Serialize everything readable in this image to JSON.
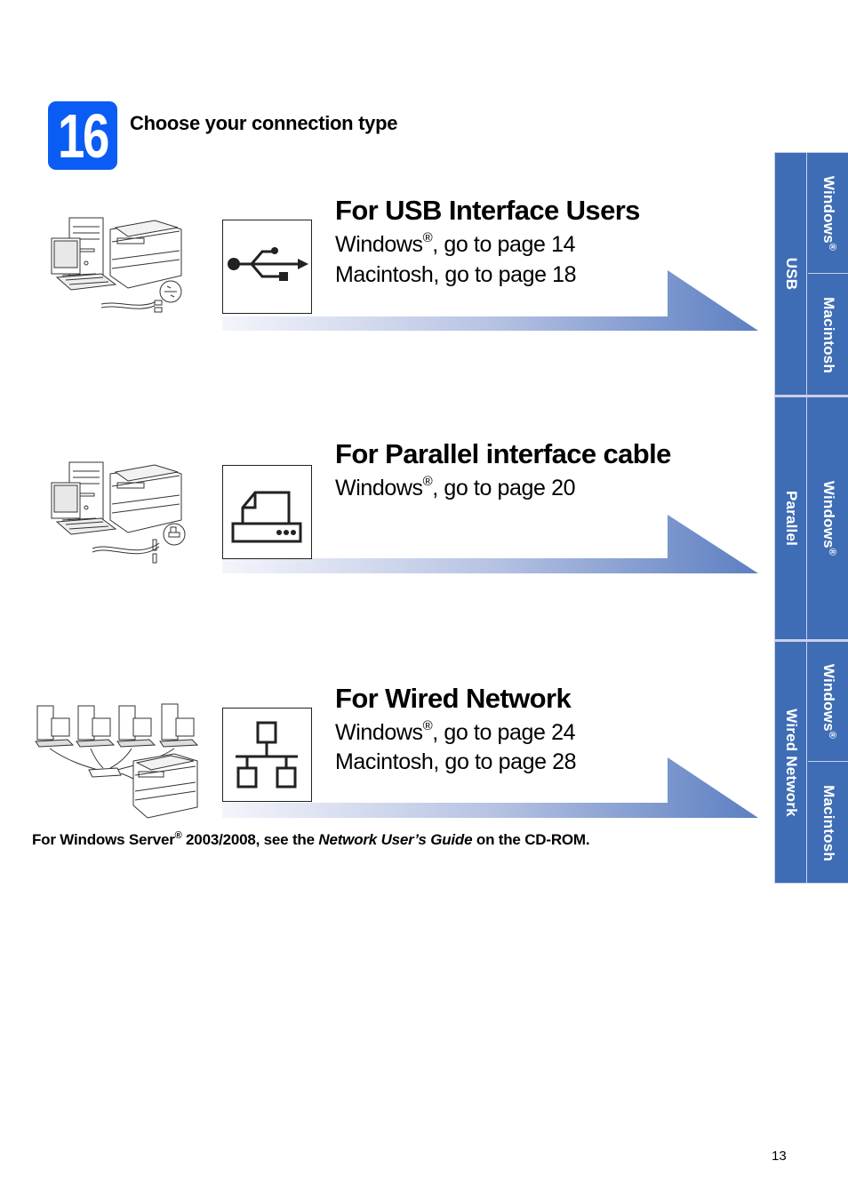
{
  "step": {
    "number": "16",
    "title": "Choose your connection type"
  },
  "colors": {
    "badge": "#0a5cf5",
    "sidebar_tab": "#3e6db5",
    "arrow_start": "#f4f5fb",
    "arrow_end": "#5d7fc2"
  },
  "sections": [
    {
      "title": "For USB Interface Users",
      "icon": "usb-icon",
      "illustration": "computer-printer-usb-cable",
      "lines": [
        {
          "os": "Windows",
          "reg": "®",
          "text": ", go to page 14"
        },
        {
          "os": "Macintosh",
          "reg": "",
          "text": ", go to page 18"
        }
      ]
    },
    {
      "title": "For Parallel interface cable",
      "icon": "parallel-printer-icon",
      "illustration": "computer-printer-parallel-cable",
      "lines": [
        {
          "os": "Windows",
          "reg": "®",
          "text": ", go to page 20"
        }
      ]
    },
    {
      "title": "For Wired Network",
      "icon": "wired-network-icon",
      "illustration": "network-computers-hub-printer",
      "lines": [
        {
          "os": "Windows",
          "reg": "®",
          "text": ", go to page 24"
        },
        {
          "os": "Macintosh",
          "reg": "",
          "text": ", go to page 28"
        }
      ]
    }
  ],
  "footnote": {
    "prefix": "For Windows Server",
    "reg": "®",
    "middle": " 2003/2008, see the ",
    "guide": "Network User’s Guide",
    "suffix": " on the CD-ROM."
  },
  "sidebar": {
    "groups": [
      {
        "label": "USB",
        "items": [
          {
            "label": "Windows",
            "reg": "®"
          },
          {
            "label": "Macintosh",
            "reg": ""
          }
        ]
      },
      {
        "label": "Parallel",
        "items": [
          {
            "label": "Windows",
            "reg": "®"
          }
        ]
      },
      {
        "label": "Wired Network",
        "items": [
          {
            "label": "Windows",
            "reg": "®"
          },
          {
            "label": "Macintosh",
            "reg": ""
          }
        ]
      }
    ]
  },
  "page_number": "13"
}
